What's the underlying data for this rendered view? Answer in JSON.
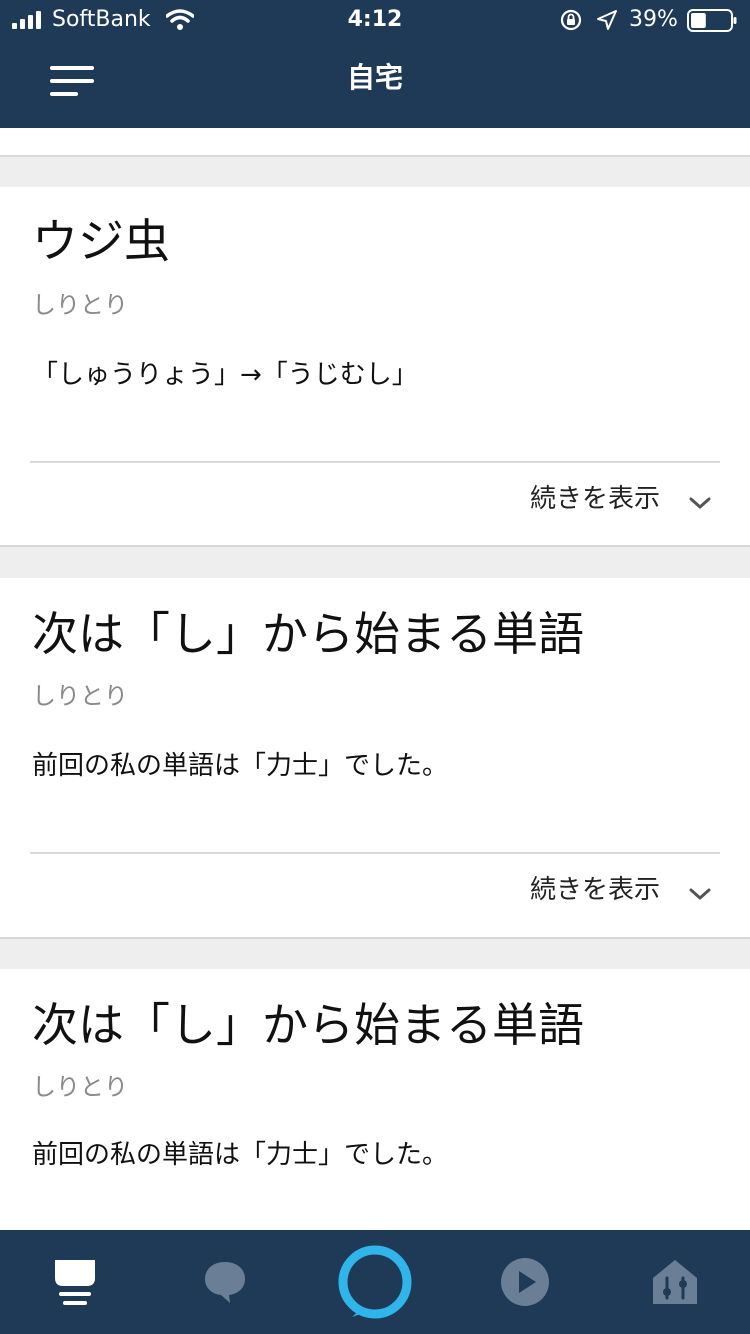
{
  "status_bar": {
    "carrier": "SoftBank",
    "time": "4:12",
    "battery_percent": "39%",
    "battery_level": 0.39
  },
  "nav": {
    "title": "自宅"
  },
  "cards": [
    {
      "title": "ウジ虫",
      "subtitle": "しりとり",
      "body": "「しゅうりょう」→「うじむし」",
      "more_label": "続きを表示"
    },
    {
      "title": "次は「し」から始まる単語",
      "subtitle": "しりとり",
      "body": "前回の私の単語は「力士」でした。",
      "more_label": "続きを表示"
    },
    {
      "title": "次は「し」から始まる単語",
      "subtitle": "しりとり",
      "body": "前回の私の単語は「力士」でした。"
    }
  ],
  "bottom_nav": {
    "active_tab": "home",
    "tabs": [
      "home-icon",
      "chat-icon",
      "alexa-icon",
      "play-icon",
      "devices-icon"
    ]
  },
  "colors": {
    "header": "#1f3a56",
    "alexa_ring": "#2fb5ea",
    "inactive_icon": "#6a7f95",
    "background": "#eeeeee"
  }
}
